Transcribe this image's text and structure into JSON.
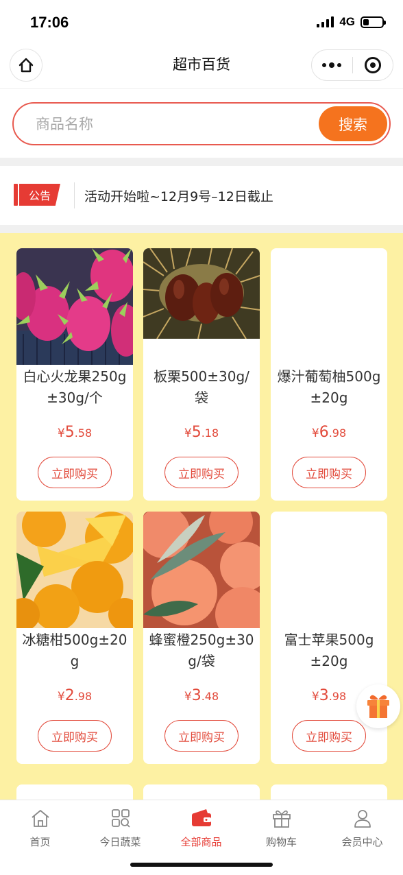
{
  "status_bar": {
    "time": "17:06",
    "network": "4G",
    "battery_level": 0.3
  },
  "header": {
    "title": "超市百货",
    "home_icon": "home-icon",
    "more_icon": "more-dots-icon",
    "close_icon": "target-circle-icon"
  },
  "search": {
    "placeholder": "商品名称",
    "button_label": "搜索"
  },
  "notice": {
    "tag": "公告",
    "text": "活动开始啦~12月9号–12日截止"
  },
  "colors": {
    "accent": "#e63b34",
    "search_button": "#f5731e",
    "price": "#e24a3b",
    "product_bg": "#fdf1a3"
  },
  "products": [
    {
      "name": "白心火龙果250g±30g/个",
      "currency": "¥",
      "price_int": "5",
      "price_dec": ".58",
      "buy_label": "立即购买",
      "image": "dragon-fruit-image"
    },
    {
      "name": "板栗500±30g/袋",
      "currency": "¥",
      "price_int": "5",
      "price_dec": ".18",
      "buy_label": "立即购买",
      "image": "chestnut-image"
    },
    {
      "name": "爆汁葡萄柚500g±20g",
      "currency": "¥",
      "price_int": "6",
      "price_dec": ".98",
      "buy_label": "立即购买",
      "image": ""
    },
    {
      "name": "冰糖柑500g±20g",
      "currency": "¥",
      "price_int": "2",
      "price_dec": ".98",
      "buy_label": "立即购买",
      "image": "orange-image"
    },
    {
      "name": "蜂蜜橙250g±30g/袋",
      "currency": "¥",
      "price_int": "3",
      "price_dec": ".48",
      "buy_label": "立即购买",
      "image": "honey-orange-image"
    },
    {
      "name": "富士苹果500g±20g",
      "currency": "¥",
      "price_int": "3",
      "price_dec": ".98",
      "buy_label": "立即购买",
      "image": ""
    }
  ],
  "tabbar": {
    "items": [
      {
        "label": "首页",
        "icon": "home-icon",
        "active": false
      },
      {
        "label": "今日蔬菜",
        "icon": "grid-search-icon",
        "active": false
      },
      {
        "label": "全部商品",
        "icon": "wallet-icon",
        "active": true
      },
      {
        "label": "购物车",
        "icon": "gift-box-icon",
        "active": false
      },
      {
        "label": "会员中心",
        "icon": "user-icon",
        "active": false
      }
    ]
  }
}
